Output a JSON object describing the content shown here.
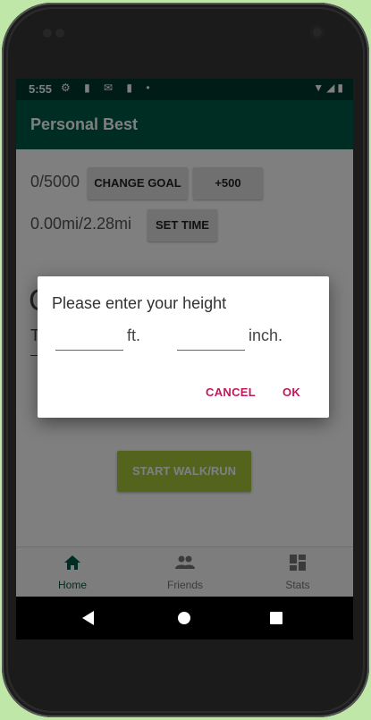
{
  "status_bar": {
    "time": "5:55",
    "left_icons": "⚙ ▮ ✉ ▮ •",
    "right_icons": "▼◢▮"
  },
  "app_bar": {
    "title": "Personal Best"
  },
  "main": {
    "steps_progress": "0/5000",
    "change_goal_label": "CHANGE GOAL",
    "plus_label": "+500",
    "distance_progress": "0.00mi/2.28mi",
    "set_time_label": "SET TIME",
    "start_label": "START WALK/RUN",
    "obscured_big_char": "C",
    "obscured_small_char": "T"
  },
  "dialog": {
    "prompt": "Please enter your height",
    "feet_unit": "ft.",
    "inch_unit": "inch.",
    "feet_value": "",
    "inch_value": "",
    "cancel_label": "CANCEL",
    "ok_label": "OK"
  },
  "bottom_nav": {
    "items": [
      {
        "label": "Home",
        "icon": "home-icon",
        "selected": true
      },
      {
        "label": "Friends",
        "icon": "people-icon",
        "selected": false
      },
      {
        "label": "Stats",
        "icon": "dashboard-icon",
        "selected": false
      }
    ]
  },
  "colors": {
    "status_bar": "#00382c",
    "app_bar": "#005a46",
    "accent_dialog_buttons": "#c2185b",
    "start_button": "#a9c83a",
    "nav_selected": "#005a46",
    "background_outer": "#bfe8a8"
  }
}
